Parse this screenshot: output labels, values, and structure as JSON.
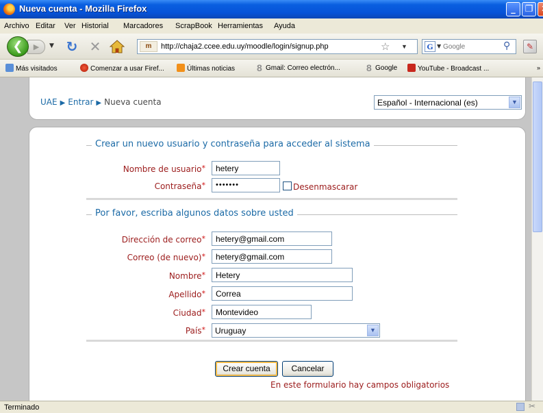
{
  "window": {
    "title": "Nueva cuenta - Mozilla Firefox"
  },
  "menu": [
    "Archivo",
    "Editar",
    "Ver",
    "Historial",
    "Marcadores",
    "ScrapBook",
    "Herramientas",
    "Ayuda"
  ],
  "nav": {
    "url": "http://chaja2.ccee.edu.uy/moodle/login/signup.php",
    "site_badge": "m",
    "search_engine": "G",
    "search_placeholder": "Google"
  },
  "bookmarks": [
    "Más visitados",
    "Comenzar a usar Firef...",
    "Últimas noticias",
    "Gmail: Correo electrón...",
    "Google",
    "YouTube - Broadcast ..."
  ],
  "bookmarks_more": "»",
  "breadcrumb": {
    "home": "UAE",
    "login": "Entrar",
    "current": "Nueva cuenta"
  },
  "language": {
    "selected": "Español - Internacional (es)"
  },
  "section1": {
    "legend": "Crear un nuevo usuario y contraseña para acceder al sistema",
    "username_label": "Nombre de usuario",
    "username_value": "hetery",
    "password_label": "Contraseña",
    "password_value": "•••••••",
    "unmask_label": "Desenmascarar"
  },
  "section2": {
    "legend": "Por favor, escriba algunos datos sobre usted",
    "email_label": "Dirección de correo",
    "email_value": "hetery@gmail.com",
    "email2_label": "Correo (de nuevo)",
    "email2_value": "hetery@gmail.com",
    "firstname_label": "Nombre",
    "firstname_value": "Hetery",
    "lastname_label": "Apellido",
    "lastname_value": "Correa",
    "city_label": "Ciudad",
    "city_value": "Montevideo",
    "country_label": "País",
    "country_value": "Uruguay"
  },
  "required_mark": "*",
  "buttons": {
    "create": "Crear cuenta",
    "cancel": "Cancelar"
  },
  "required_note": "En este formulario hay campos obligatorios",
  "status": "Terminado"
}
